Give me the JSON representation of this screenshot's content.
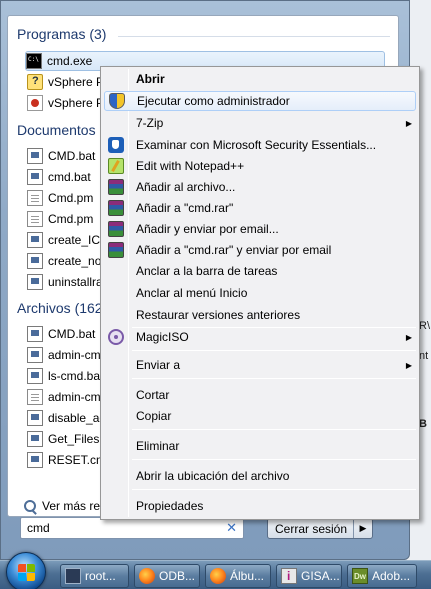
{
  "start_menu": {
    "groups": [
      {
        "title": "Programas (3)",
        "items": [
          {
            "label": "cmd.exe",
            "icon": "cmd-icon"
          },
          {
            "label": "vSphere P",
            "icon": "help-icon"
          },
          {
            "label": "vSphere P",
            "icon": "vsphere-icon"
          }
        ]
      },
      {
        "title": "Documentos",
        "items": [
          {
            "label": "CMD.bat",
            "icon": "bat-file-icon"
          },
          {
            "label": "cmd.bat",
            "icon": "bat-file-icon"
          },
          {
            "label": "Cmd.pm",
            "icon": "file-icon"
          },
          {
            "label": "Cmd.pm",
            "icon": "file-icon"
          },
          {
            "label": "create_ICL",
            "icon": "bat-file-icon"
          },
          {
            "label": "create_no",
            "icon": "bat-file-icon"
          },
          {
            "label": "uninstallra",
            "icon": "bat-file-icon"
          }
        ]
      },
      {
        "title": "Archivos (162",
        "items": [
          {
            "label": "CMD.bat",
            "icon": "bat-file-icon"
          },
          {
            "label": "admin-cm",
            "icon": "bat-file-icon"
          },
          {
            "label": "ls-cmd.ba",
            "icon": "bat-file-icon"
          },
          {
            "label": "admin-cm",
            "icon": "file-icon"
          },
          {
            "label": "disable_ad",
            "icon": "bat-file-icon"
          },
          {
            "label": "Get_Files.c",
            "icon": "bat-file-icon"
          },
          {
            "label": "RESET.cm",
            "icon": "bat-file-icon"
          }
        ]
      }
    ],
    "more_results": "Ver más resu",
    "search": {
      "value": "cmd",
      "clear_glyph": "✕"
    },
    "shutdown": {
      "label": "Cerrar sesión",
      "arrow": "▶"
    }
  },
  "context_menu": {
    "items": [
      {
        "label": "Abrir",
        "bold": true,
        "icon": null,
        "submenu": false
      },
      {
        "label": "Ejecutar como administrador",
        "icon": "uac-shield-icon",
        "highlighted": true,
        "submenu": false
      },
      {
        "label": "7-Zip",
        "icon": null,
        "submenu": true
      },
      {
        "label": "Examinar con Microsoft Security Essentials...",
        "icon": "security-essentials-icon",
        "submenu": false
      },
      {
        "label": "Edit with Notepad++",
        "icon": "notepad-plus-plus-icon",
        "submenu": false
      },
      {
        "label": "Añadir al archivo...",
        "icon": "winrar-icon",
        "submenu": false
      },
      {
        "label": "Añadir a \"cmd.rar\"",
        "icon": "winrar-icon",
        "submenu": false
      },
      {
        "label": "Añadir y enviar por email...",
        "icon": "winrar-icon",
        "submenu": false
      },
      {
        "label": "Añadir a \"cmd.rar\" y enviar por email",
        "icon": "winrar-icon",
        "submenu": false
      },
      {
        "label": "Anclar a la barra de tareas",
        "icon": null,
        "submenu": false
      },
      {
        "label": "Anclar al menú Inicio",
        "icon": null,
        "submenu": false
      },
      {
        "label": "Restaurar versiones anteriores",
        "icon": null,
        "submenu": false
      },
      {
        "label": "MagicISO",
        "icon": "magiciso-icon",
        "submenu": true
      },
      {
        "label": "Enviar a",
        "icon": null,
        "submenu": true
      },
      {
        "label": "Cortar",
        "icon": null,
        "submenu": false
      },
      {
        "label": "Copiar",
        "icon": null,
        "submenu": false
      },
      {
        "label": "Eliminar",
        "icon": null,
        "submenu": false
      },
      {
        "label": "Abrir la ubicación del archivo",
        "icon": null,
        "submenu": false
      },
      {
        "label": "Propiedades",
        "icon": null,
        "submenu": false
      }
    ],
    "submenu_glyph": "▶"
  },
  "background_window": {
    "fragments": [
      "R\\",
      "nt",
      "B"
    ]
  },
  "taskbar": {
    "buttons": [
      {
        "label": "root...",
        "icon": "terminal-icon"
      },
      {
        "label": "ODB...",
        "icon": "firefox-icon"
      },
      {
        "label": "Álbu...",
        "icon": "firefox-icon"
      },
      {
        "label": "GISA...",
        "icon": "gisa-icon"
      },
      {
        "label": "Adob...",
        "icon": "dreamweaver-icon"
      }
    ],
    "dw_badge": "Dw"
  },
  "colors": {
    "menu_highlight_border": "#aecff7",
    "group_title": "#1e3a6e",
    "taskbar": "#4d6f93"
  }
}
